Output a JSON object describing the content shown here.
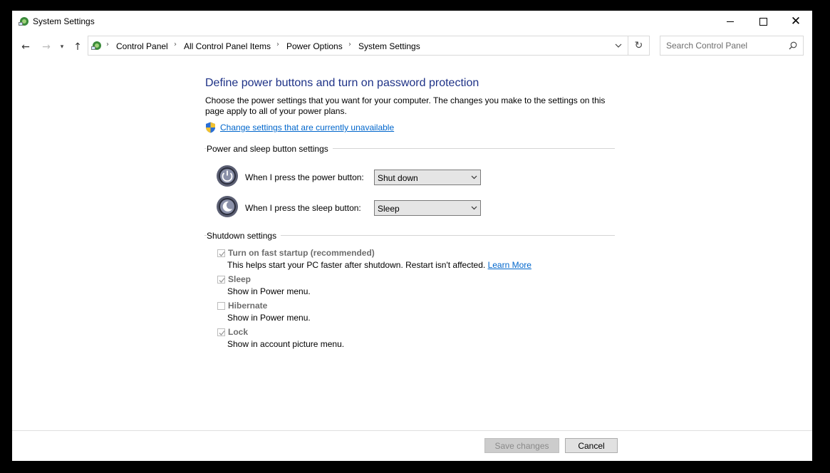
{
  "window": {
    "title": "System Settings"
  },
  "nav": {
    "breadcrumbs": [
      "Control Panel",
      "All Control Panel Items",
      "Power Options",
      "System Settings"
    ]
  },
  "search": {
    "placeholder": "Search Control Panel"
  },
  "main": {
    "heading": "Define power buttons and turn on password protection",
    "description": "Choose the power settings that you want for your computer. The changes you make to the settings on this page apply to all of your power plans.",
    "change_link": "Change settings that are currently unavailable"
  },
  "power_sleep": {
    "title": "Power and sleep button settings",
    "power_label": "When I press the power button:",
    "power_value": "Shut down",
    "sleep_label": "When I press the sleep button:",
    "sleep_value": "Sleep"
  },
  "shutdown": {
    "title": "Shutdown settings",
    "items": [
      {
        "label": "Turn on fast startup (recommended)",
        "desc": "This helps start your PC faster after shutdown. Restart isn't affected.",
        "link": "Learn More",
        "checked": true
      },
      {
        "label": "Sleep",
        "desc": "Show in Power menu.",
        "checked": true
      },
      {
        "label": "Hibernate",
        "desc": "Show in Power menu.",
        "checked": false
      },
      {
        "label": "Lock",
        "desc": "Show in account picture menu.",
        "checked": true
      }
    ]
  },
  "footer": {
    "save_label": "Save changes",
    "cancel_label": "Cancel"
  },
  "colors": {
    "heading": "#1e3287",
    "link": "#0066cc",
    "disabled_text": "#6d6d6d"
  }
}
